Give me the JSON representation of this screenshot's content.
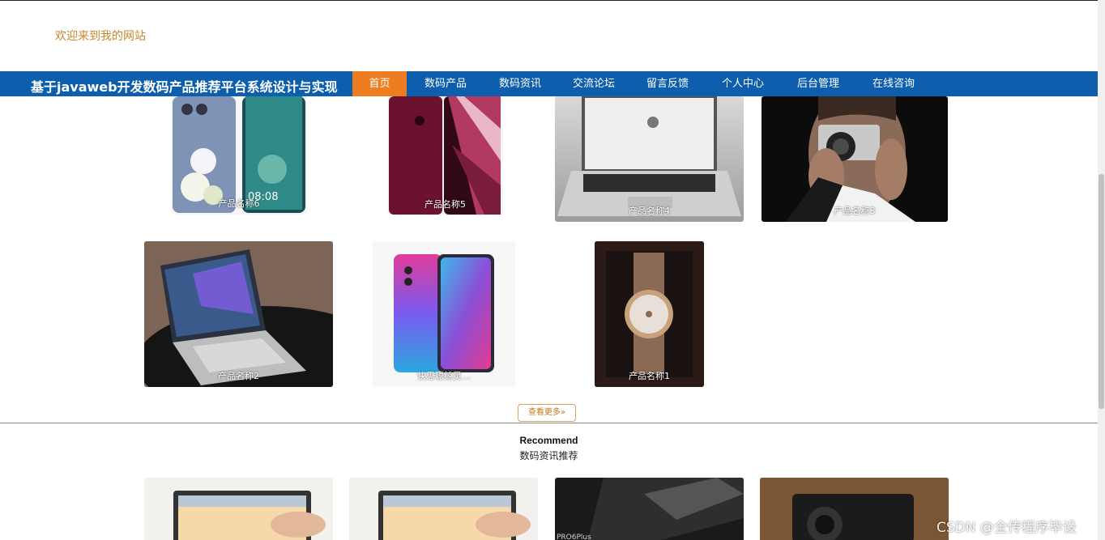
{
  "header": {
    "welcome": "欢迎来到我的网站",
    "site_title": "基于javaweb开发数码产品推荐平台系统设计与实现"
  },
  "nav": {
    "items": [
      {
        "label": "首页",
        "active": true
      },
      {
        "label": "数码产品"
      },
      {
        "label": "数码资讯"
      },
      {
        "label": "交流论坛"
      },
      {
        "label": "留言反馈"
      },
      {
        "label": "个人中心"
      },
      {
        "label": "后台管理"
      },
      {
        "label": "在线咨询"
      }
    ]
  },
  "products": {
    "row1": [
      {
        "caption": "产品名称6",
        "icon": "phone-image"
      },
      {
        "caption": "产品名称5",
        "icon": "phone-image"
      },
      {
        "caption": "产品名称4",
        "icon": "laptop-image"
      },
      {
        "caption": "产品名称3",
        "icon": "camera-image"
      }
    ],
    "row2": [
      {
        "caption": "产品名称2",
        "icon": "laptop-image"
      },
      {
        "caption": "快思聪鲸灵…",
        "icon": "phone-image"
      },
      {
        "caption": "产品名称1",
        "icon": "watch-image"
      }
    ],
    "more_label": "查看更多"
  },
  "recommend": {
    "title_en": "Recommend",
    "title_cn": "数码资讯推荐"
  },
  "news_cards": [
    {
      "icon": "tablet-image",
      "overlay": ""
    },
    {
      "icon": "tablet-image",
      "overlay": ""
    },
    {
      "icon": "phone-image",
      "overlay": "PRO6Plus"
    },
    {
      "icon": "camera-image",
      "overlay": ""
    }
  ],
  "watermark": "CSDN @全传程序毕设",
  "colors": {
    "nav_bg": "#0d5fae",
    "nav_active": "#ee7d21",
    "welcome": "#c8872e",
    "more_border": "#d9a35b"
  }
}
